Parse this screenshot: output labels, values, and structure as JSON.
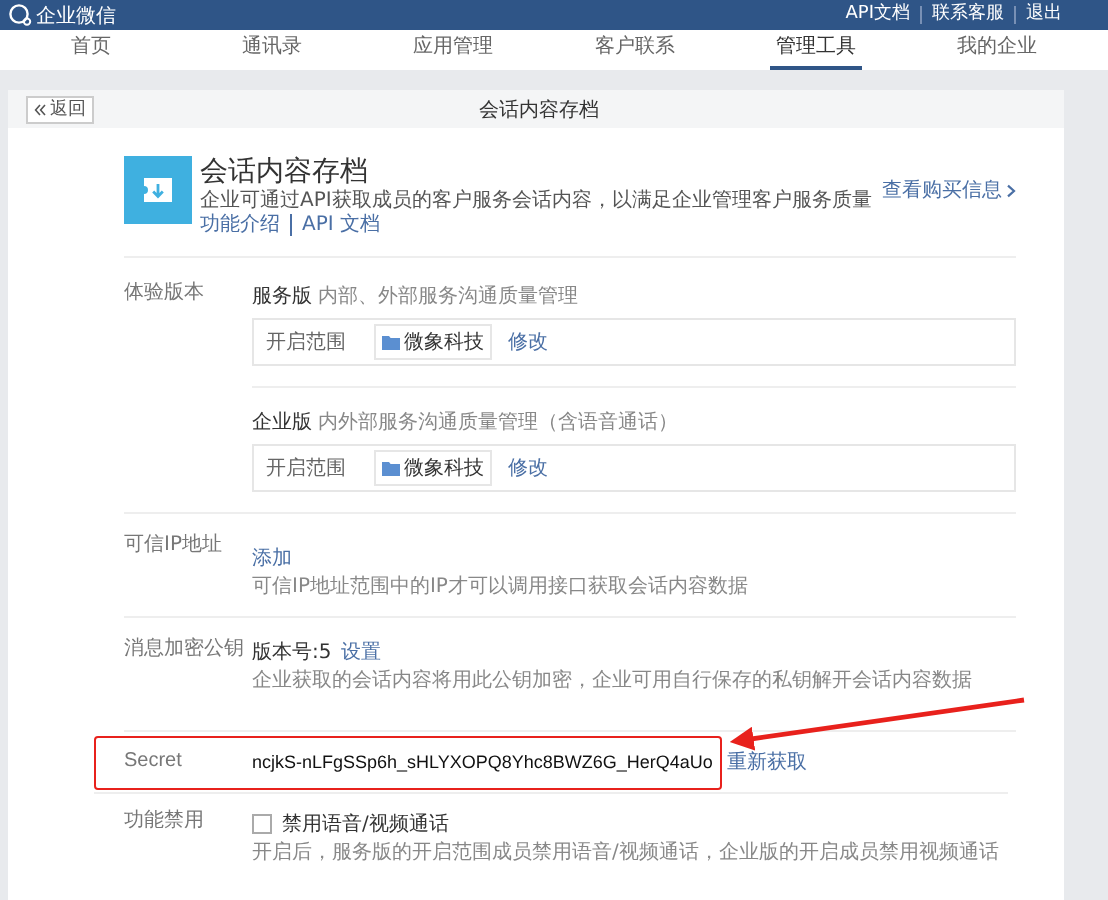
{
  "top_bar": {
    "logo": "企业微信",
    "links": [
      "API文档",
      "联系客服",
      "退出"
    ]
  },
  "nav_tabs": [
    {
      "label": "首页",
      "selected": false
    },
    {
      "label": "通讯录",
      "selected": false
    },
    {
      "label": "应用管理",
      "selected": false
    },
    {
      "label": "客户联系",
      "selected": false
    },
    {
      "label": "管理工具",
      "selected": true
    },
    {
      "label": "我的企业",
      "selected": false
    }
  ],
  "page_header": {
    "back_button": "返回",
    "title": "会话内容存档"
  },
  "app": {
    "title": "会话内容存档",
    "description": "企业可通过API获取成员的客户服务会话内容，以满足企业管理客户服务质量",
    "links": [
      "功能介绍",
      "API 文档"
    ],
    "purchase_link": "查看购买信息"
  },
  "sections": [
    {
      "kind": "editions",
      "label": "体验版本",
      "editions": [
        {
          "name": "服务版",
          "note": "内部、外部服务沟通质量管理",
          "scope_label": "开启范围",
          "scope_value": "微象科技",
          "edit": "修改"
        },
        {
          "name": "企业版",
          "note": "内外部服务沟通质量管理（含语音通话）",
          "scope_label": "开启范围",
          "scope_value": "微象科技",
          "edit": "修改"
        }
      ]
    },
    {
      "kind": "link",
      "label": "可信IP地址",
      "action": "添加",
      "hint": "可信IP地址范围中的IP才可以调用接口获取会话内容数据"
    },
    {
      "kind": "version",
      "label": "消息加密公钥",
      "value": "版本号:5",
      "action": "设置",
      "hint": "企业获取的会话内容将用此公钥加密，企业可用自行保存的私钥解开会话内容数据"
    },
    {
      "kind": "secret",
      "label": "Secret",
      "value": "ncjkS-nLFgSSp6h_sHLYXOPQ8Yhc8BWZ6G_HerQ4aUo",
      "action": "重新获取",
      "highlighted": true
    },
    {
      "kind": "checkbox",
      "label": "功能禁用",
      "option": "禁用语音/视频通话",
      "checked": false,
      "hint": "开启后，服务版的开启范围成员禁用语音/视频通话，企业版的开启成员禁用视频通话"
    }
  ]
}
